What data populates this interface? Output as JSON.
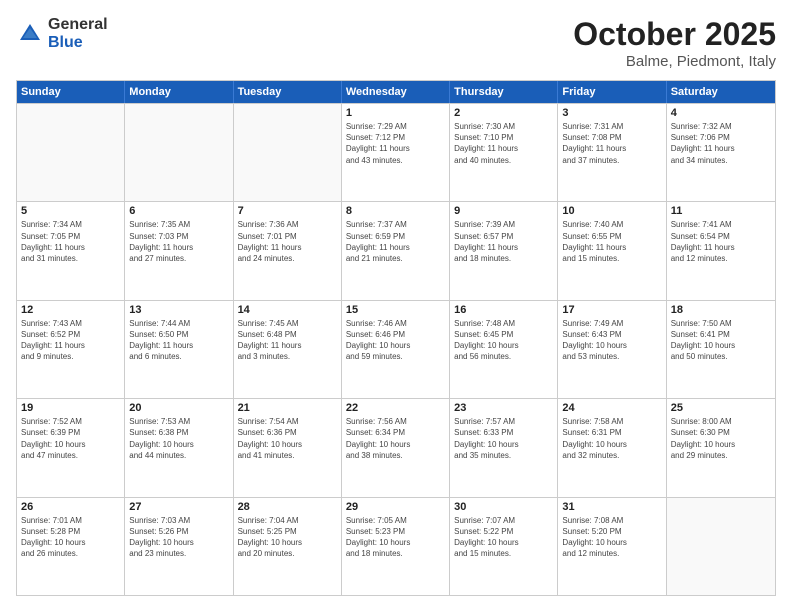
{
  "logo": {
    "general": "General",
    "blue": "Blue"
  },
  "title": "October 2025",
  "subtitle": "Balme, Piedmont, Italy",
  "header": {
    "days": [
      "Sunday",
      "Monday",
      "Tuesday",
      "Wednesday",
      "Thursday",
      "Friday",
      "Saturday"
    ]
  },
  "weeks": [
    [
      {
        "day": "",
        "lines": []
      },
      {
        "day": "",
        "lines": []
      },
      {
        "day": "",
        "lines": []
      },
      {
        "day": "1",
        "lines": [
          "Sunrise: 7:29 AM",
          "Sunset: 7:12 PM",
          "Daylight: 11 hours",
          "and 43 minutes."
        ]
      },
      {
        "day": "2",
        "lines": [
          "Sunrise: 7:30 AM",
          "Sunset: 7:10 PM",
          "Daylight: 11 hours",
          "and 40 minutes."
        ]
      },
      {
        "day": "3",
        "lines": [
          "Sunrise: 7:31 AM",
          "Sunset: 7:08 PM",
          "Daylight: 11 hours",
          "and 37 minutes."
        ]
      },
      {
        "day": "4",
        "lines": [
          "Sunrise: 7:32 AM",
          "Sunset: 7:06 PM",
          "Daylight: 11 hours",
          "and 34 minutes."
        ]
      }
    ],
    [
      {
        "day": "5",
        "lines": [
          "Sunrise: 7:34 AM",
          "Sunset: 7:05 PM",
          "Daylight: 11 hours",
          "and 31 minutes."
        ]
      },
      {
        "day": "6",
        "lines": [
          "Sunrise: 7:35 AM",
          "Sunset: 7:03 PM",
          "Daylight: 11 hours",
          "and 27 minutes."
        ]
      },
      {
        "day": "7",
        "lines": [
          "Sunrise: 7:36 AM",
          "Sunset: 7:01 PM",
          "Daylight: 11 hours",
          "and 24 minutes."
        ]
      },
      {
        "day": "8",
        "lines": [
          "Sunrise: 7:37 AM",
          "Sunset: 6:59 PM",
          "Daylight: 11 hours",
          "and 21 minutes."
        ]
      },
      {
        "day": "9",
        "lines": [
          "Sunrise: 7:39 AM",
          "Sunset: 6:57 PM",
          "Daylight: 11 hours",
          "and 18 minutes."
        ]
      },
      {
        "day": "10",
        "lines": [
          "Sunrise: 7:40 AM",
          "Sunset: 6:55 PM",
          "Daylight: 11 hours",
          "and 15 minutes."
        ]
      },
      {
        "day": "11",
        "lines": [
          "Sunrise: 7:41 AM",
          "Sunset: 6:54 PM",
          "Daylight: 11 hours",
          "and 12 minutes."
        ]
      }
    ],
    [
      {
        "day": "12",
        "lines": [
          "Sunrise: 7:43 AM",
          "Sunset: 6:52 PM",
          "Daylight: 11 hours",
          "and 9 minutes."
        ]
      },
      {
        "day": "13",
        "lines": [
          "Sunrise: 7:44 AM",
          "Sunset: 6:50 PM",
          "Daylight: 11 hours",
          "and 6 minutes."
        ]
      },
      {
        "day": "14",
        "lines": [
          "Sunrise: 7:45 AM",
          "Sunset: 6:48 PM",
          "Daylight: 11 hours",
          "and 3 minutes."
        ]
      },
      {
        "day": "15",
        "lines": [
          "Sunrise: 7:46 AM",
          "Sunset: 6:46 PM",
          "Daylight: 10 hours",
          "and 59 minutes."
        ]
      },
      {
        "day": "16",
        "lines": [
          "Sunrise: 7:48 AM",
          "Sunset: 6:45 PM",
          "Daylight: 10 hours",
          "and 56 minutes."
        ]
      },
      {
        "day": "17",
        "lines": [
          "Sunrise: 7:49 AM",
          "Sunset: 6:43 PM",
          "Daylight: 10 hours",
          "and 53 minutes."
        ]
      },
      {
        "day": "18",
        "lines": [
          "Sunrise: 7:50 AM",
          "Sunset: 6:41 PM",
          "Daylight: 10 hours",
          "and 50 minutes."
        ]
      }
    ],
    [
      {
        "day": "19",
        "lines": [
          "Sunrise: 7:52 AM",
          "Sunset: 6:39 PM",
          "Daylight: 10 hours",
          "and 47 minutes."
        ]
      },
      {
        "day": "20",
        "lines": [
          "Sunrise: 7:53 AM",
          "Sunset: 6:38 PM",
          "Daylight: 10 hours",
          "and 44 minutes."
        ]
      },
      {
        "day": "21",
        "lines": [
          "Sunrise: 7:54 AM",
          "Sunset: 6:36 PM",
          "Daylight: 10 hours",
          "and 41 minutes."
        ]
      },
      {
        "day": "22",
        "lines": [
          "Sunrise: 7:56 AM",
          "Sunset: 6:34 PM",
          "Daylight: 10 hours",
          "and 38 minutes."
        ]
      },
      {
        "day": "23",
        "lines": [
          "Sunrise: 7:57 AM",
          "Sunset: 6:33 PM",
          "Daylight: 10 hours",
          "and 35 minutes."
        ]
      },
      {
        "day": "24",
        "lines": [
          "Sunrise: 7:58 AM",
          "Sunset: 6:31 PM",
          "Daylight: 10 hours",
          "and 32 minutes."
        ]
      },
      {
        "day": "25",
        "lines": [
          "Sunrise: 8:00 AM",
          "Sunset: 6:30 PM",
          "Daylight: 10 hours",
          "and 29 minutes."
        ]
      }
    ],
    [
      {
        "day": "26",
        "lines": [
          "Sunrise: 7:01 AM",
          "Sunset: 5:28 PM",
          "Daylight: 10 hours",
          "and 26 minutes."
        ]
      },
      {
        "day": "27",
        "lines": [
          "Sunrise: 7:03 AM",
          "Sunset: 5:26 PM",
          "Daylight: 10 hours",
          "and 23 minutes."
        ]
      },
      {
        "day": "28",
        "lines": [
          "Sunrise: 7:04 AM",
          "Sunset: 5:25 PM",
          "Daylight: 10 hours",
          "and 20 minutes."
        ]
      },
      {
        "day": "29",
        "lines": [
          "Sunrise: 7:05 AM",
          "Sunset: 5:23 PM",
          "Daylight: 10 hours",
          "and 18 minutes."
        ]
      },
      {
        "day": "30",
        "lines": [
          "Sunrise: 7:07 AM",
          "Sunset: 5:22 PM",
          "Daylight: 10 hours",
          "and 15 minutes."
        ]
      },
      {
        "day": "31",
        "lines": [
          "Sunrise: 7:08 AM",
          "Sunset: 5:20 PM",
          "Daylight: 10 hours",
          "and 12 minutes."
        ]
      },
      {
        "day": "",
        "lines": []
      }
    ]
  ]
}
